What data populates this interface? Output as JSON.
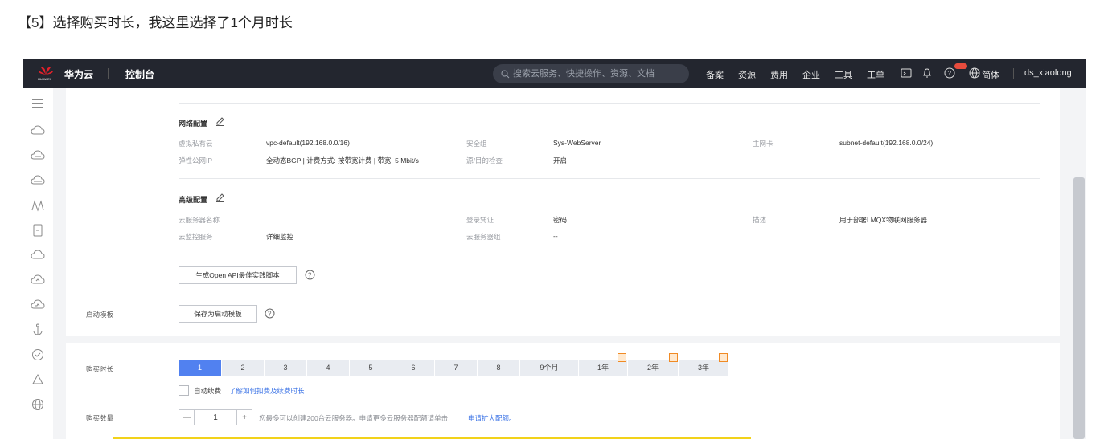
{
  "caption": "【5】选择购买时长，我这里选择了1个月时长",
  "topbar": {
    "logo_text": "HUAWEI",
    "brand": "华为云",
    "console": "控制台",
    "search_placeholder": "搜索云服务、快捷操作、资源、文档",
    "nav": [
      "备案",
      "资源",
      "费用",
      "企业",
      "工具",
      "工单"
    ],
    "language": "简体",
    "username": "ds_xiaolong",
    "accent_color": "#e84c3d"
  },
  "network": {
    "title": "网络配置",
    "rows": [
      {
        "label1": "虚拟私有云",
        "value1": "vpc-default(192.168.0.0/16)",
        "label2": "安全组",
        "value2": "Sys-WebServer",
        "label3": "主网卡",
        "value3": "subnet-default(192.168.0.0/24)"
      },
      {
        "label1": "弹性公网IP",
        "value1": "全动态BGP | 计费方式: 按带宽计费 | 带宽: 5 Mbit/s",
        "label2": "源/目的检查",
        "value2": "开启",
        "label3": "",
        "value3": ""
      }
    ]
  },
  "advanced": {
    "title": "高级配置",
    "rows": [
      {
        "label1": "云服务器名称",
        "value1": "",
        "label2": "登录凭证",
        "value2": "密码",
        "label3": "描述",
        "value3": "用于部署LMQX物联网服务器"
      },
      {
        "label1": "云监控服务",
        "value1": "详细监控",
        "label2": "云服务器组",
        "value2": "--",
        "label3": "",
        "value3": ""
      }
    ],
    "api_button": "生成Open API最佳实践脚本"
  },
  "template": {
    "label": "启动模板",
    "button": "保存为启动模板"
  },
  "duration": {
    "label": "购买时长",
    "options": [
      "1",
      "2",
      "3",
      "4",
      "5",
      "6",
      "7",
      "8",
      "9个月",
      "1年",
      "2年",
      "3年"
    ],
    "selected": "1",
    "promo_options": [
      "1年",
      "2年",
      "3年"
    ],
    "auto_renew": "自动续费",
    "renew_link": "了解如何扣费及续费时长"
  },
  "quantity": {
    "label": "购买数量",
    "value": "1",
    "minus": "—",
    "plus": "+",
    "hint": "您最多可以创建200台云服务器。申请更多云服务器配额请单击",
    "hint_link": "申请扩大配额。"
  }
}
